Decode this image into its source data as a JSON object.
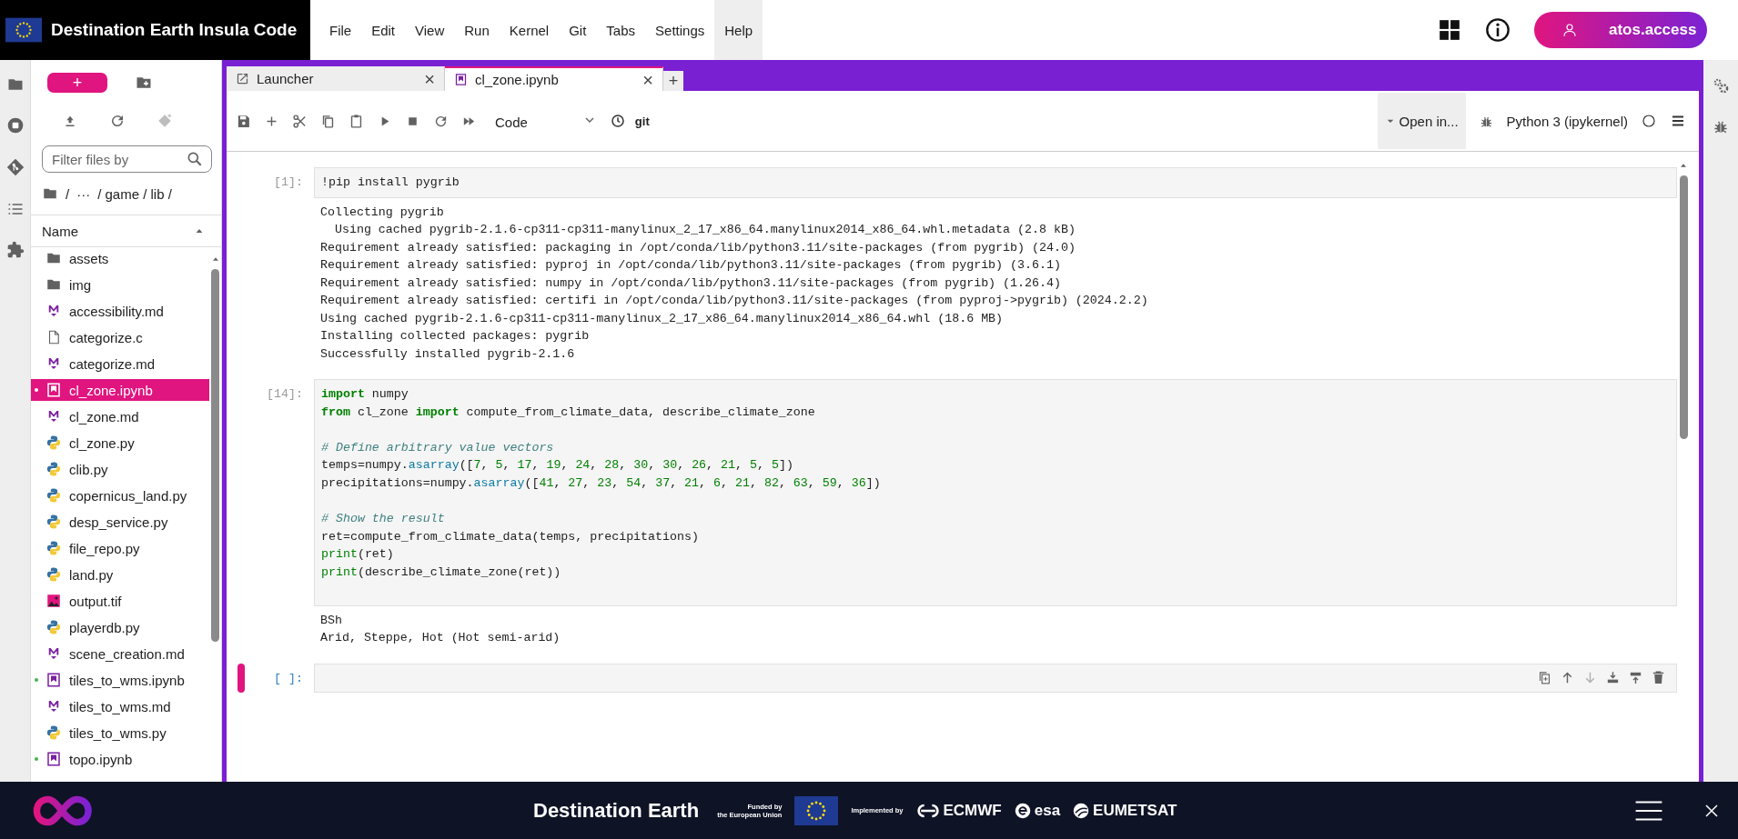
{
  "header": {
    "title": "Destination Earth Insula Code",
    "menu": [
      {
        "label": "File",
        "selected": false
      },
      {
        "label": "Edit",
        "selected": false
      },
      {
        "label": "View",
        "selected": false
      },
      {
        "label": "Run",
        "selected": false
      },
      {
        "label": "Kernel",
        "selected": false
      },
      {
        "label": "Git",
        "selected": false
      },
      {
        "label": "Tabs",
        "selected": false
      },
      {
        "label": "Settings",
        "selected": false
      },
      {
        "label": "Help",
        "selected": true
      }
    ],
    "user": "atos.access"
  },
  "file_browser": {
    "new_button": "+",
    "filter_placeholder": "Filter files by",
    "breadcrumb": [
      "/",
      "···",
      "/ game / lib /"
    ],
    "column": "Name",
    "files": [
      {
        "name": "assets",
        "kind": "folder",
        "selected": false,
        "running": false
      },
      {
        "name": "img",
        "kind": "folder",
        "selected": false,
        "running": false
      },
      {
        "name": "accessibility.md",
        "kind": "markdown",
        "selected": false,
        "running": false
      },
      {
        "name": "categorize.c",
        "kind": "file",
        "selected": false,
        "running": false
      },
      {
        "name": "categorize.md",
        "kind": "markdown",
        "selected": false,
        "running": false
      },
      {
        "name": "cl_zone.ipynb",
        "kind": "notebook",
        "selected": true,
        "running": true
      },
      {
        "name": "cl_zone.md",
        "kind": "markdown",
        "selected": false,
        "running": false
      },
      {
        "name": "cl_zone.py",
        "kind": "python",
        "selected": false,
        "running": false
      },
      {
        "name": "clib.py",
        "kind": "python",
        "selected": false,
        "running": false
      },
      {
        "name": "copernicus_land.py",
        "kind": "python",
        "selected": false,
        "running": false
      },
      {
        "name": "desp_service.py",
        "kind": "python",
        "selected": false,
        "running": false
      },
      {
        "name": "file_repo.py",
        "kind": "python",
        "selected": false,
        "running": false
      },
      {
        "name": "land.py",
        "kind": "python",
        "selected": false,
        "running": false
      },
      {
        "name": "output.tif",
        "kind": "image",
        "selected": false,
        "running": false
      },
      {
        "name": "playerdb.py",
        "kind": "python",
        "selected": false,
        "running": false
      },
      {
        "name": "scene_creation.md",
        "kind": "markdown",
        "selected": false,
        "running": false
      },
      {
        "name": "tiles_to_wms.ipynb",
        "kind": "notebook",
        "selected": false,
        "running": true
      },
      {
        "name": "tiles_to_wms.md",
        "kind": "markdown",
        "selected": false,
        "running": false
      },
      {
        "name": "tiles_to_wms.py",
        "kind": "python",
        "selected": false,
        "running": false
      },
      {
        "name": "topo.ipynb",
        "kind": "notebook",
        "selected": false,
        "running": true
      }
    ]
  },
  "notebook": {
    "tabs": [
      {
        "label": "Launcher",
        "kind": "launcher",
        "selected": false,
        "close": "×"
      },
      {
        "label": "cl_zone.ipynb",
        "kind": "notebook",
        "selected": true,
        "close": "×"
      }
    ],
    "add_tab": "+",
    "cell_type": "Code",
    "git_label": "git",
    "open_in": "Open in...",
    "kernel": "Python 3 (ipykernel)",
    "cells": [
      {
        "prompt": "[1]:",
        "active": false,
        "input": [
          {
            "gap_before": false,
            "tokens": [
              {
                "kind": "plain",
                "text": "!pip install pygrib"
              }
            ]
          }
        ],
        "output": [
          "Collecting pygrib",
          "  Using cached pygrib-2.1.6-cp311-cp311-manylinux_2_17_x86_64.manylinux2014_x86_64.whl.metadata (2.8 kB)",
          "Requirement already satisfied: packaging in /opt/conda/lib/python3.11/site-packages (from pygrib) (24.0)",
          "Requirement already satisfied: pyproj in /opt/conda/lib/python3.11/site-packages (from pygrib) (3.6.1)",
          "Requirement already satisfied: numpy in /opt/conda/lib/python3.11/site-packages (from pygrib) (1.26.4)",
          "Requirement already satisfied: certifi in /opt/conda/lib/python3.11/site-packages (from pyproj->pygrib) (2024.2.2)",
          "Using cached pygrib-2.1.6-cp311-cp311-manylinux_2_17_x86_64.manylinux2014_x86_64.whl (18.6 MB)",
          "Installing collected packages: pygrib",
          "Successfully installed pygrib-2.1.6"
        ]
      },
      {
        "prompt": "[14]:",
        "active": false,
        "input": [
          {
            "gap_before": false,
            "tokens": [
              {
                "kind": "keyword",
                "text": "import"
              },
              {
                "kind": "plain",
                "text": " numpy"
              }
            ]
          },
          {
            "gap_before": false,
            "tokens": [
              {
                "kind": "keyword",
                "text": "from"
              },
              {
                "kind": "plain",
                "text": " cl_zone "
              },
              {
                "kind": "keyword",
                "text": "import"
              },
              {
                "kind": "plain",
                "text": " compute_from_climate_data, describe_climate_zone"
              }
            ]
          },
          {
            "gap_before": true,
            "tokens": [
              {
                "kind": "comment",
                "text": "# Define arbitrary value vectors"
              }
            ]
          },
          {
            "gap_before": false,
            "tokens": [
              {
                "kind": "plain",
                "text": "temps=numpy."
              },
              {
                "kind": "method",
                "text": "asarray"
              },
              {
                "kind": "plain",
                "text": "(["
              },
              {
                "kind": "number",
                "text": "7"
              },
              {
                "kind": "plain",
                "text": ", "
              },
              {
                "kind": "number",
                "text": "5"
              },
              {
                "kind": "plain",
                "text": ", "
              },
              {
                "kind": "number",
                "text": "17"
              },
              {
                "kind": "plain",
                "text": ", "
              },
              {
                "kind": "number",
                "text": "19"
              },
              {
                "kind": "plain",
                "text": ", "
              },
              {
                "kind": "number",
                "text": "24"
              },
              {
                "kind": "plain",
                "text": ", "
              },
              {
                "kind": "number",
                "text": "28"
              },
              {
                "kind": "plain",
                "text": ", "
              },
              {
                "kind": "number",
                "text": "30"
              },
              {
                "kind": "plain",
                "text": ", "
              },
              {
                "kind": "number",
                "text": "30"
              },
              {
                "kind": "plain",
                "text": ", "
              },
              {
                "kind": "number",
                "text": "26"
              },
              {
                "kind": "plain",
                "text": ", "
              },
              {
                "kind": "number",
                "text": "21"
              },
              {
                "kind": "plain",
                "text": ", "
              },
              {
                "kind": "number",
                "text": "5"
              },
              {
                "kind": "plain",
                "text": ", "
              },
              {
                "kind": "number",
                "text": "5"
              },
              {
                "kind": "plain",
                "text": "])"
              }
            ]
          },
          {
            "gap_before": false,
            "tokens": [
              {
                "kind": "plain",
                "text": "precipitations=numpy."
              },
              {
                "kind": "method",
                "text": "asarray"
              },
              {
                "kind": "plain",
                "text": "(["
              },
              {
                "kind": "number",
                "text": "41"
              },
              {
                "kind": "plain",
                "text": ", "
              },
              {
                "kind": "number",
                "text": "27"
              },
              {
                "kind": "plain",
                "text": ", "
              },
              {
                "kind": "number",
                "text": "23"
              },
              {
                "kind": "plain",
                "text": ", "
              },
              {
                "kind": "number",
                "text": "54"
              },
              {
                "kind": "plain",
                "text": ", "
              },
              {
                "kind": "number",
                "text": "37"
              },
              {
                "kind": "plain",
                "text": ", "
              },
              {
                "kind": "number",
                "text": "21"
              },
              {
                "kind": "plain",
                "text": ", "
              },
              {
                "kind": "number",
                "text": "6"
              },
              {
                "kind": "plain",
                "text": ", "
              },
              {
                "kind": "number",
                "text": "21"
              },
              {
                "kind": "plain",
                "text": ", "
              },
              {
                "kind": "number",
                "text": "82"
              },
              {
                "kind": "plain",
                "text": ", "
              },
              {
                "kind": "number",
                "text": "63"
              },
              {
                "kind": "plain",
                "text": ", "
              },
              {
                "kind": "number",
                "text": "59"
              },
              {
                "kind": "plain",
                "text": ", "
              },
              {
                "kind": "number",
                "text": "36"
              },
              {
                "kind": "plain",
                "text": "])"
              }
            ]
          },
          {
            "gap_before": true,
            "tokens": [
              {
                "kind": "comment",
                "text": "# Show the result"
              }
            ]
          },
          {
            "gap_before": false,
            "tokens": [
              {
                "kind": "plain",
                "text": "ret=compute_from_climate_data(temps, precipitations)"
              }
            ]
          },
          {
            "gap_before": false,
            "tokens": [
              {
                "kind": "builtin",
                "text": "print"
              },
              {
                "kind": "plain",
                "text": "(ret)"
              }
            ]
          },
          {
            "gap_before": false,
            "tokens": [
              {
                "kind": "builtin",
                "text": "print"
              },
              {
                "kind": "plain",
                "text": "(describe_climate_zone(ret))"
              }
            ]
          }
        ],
        "output": [
          "BSh",
          "Arid, Steppe, Hot (Hot semi-arid)"
        ]
      },
      {
        "prompt": "[ ]:",
        "active": true
      }
    ]
  },
  "footer": {
    "brand": "Destination Earth",
    "funded": [
      "Funded by",
      "the European Union"
    ],
    "implemented": "Implemented by",
    "partners": [
      "ECMWF",
      "esa",
      "EUMETSAT"
    ]
  }
}
